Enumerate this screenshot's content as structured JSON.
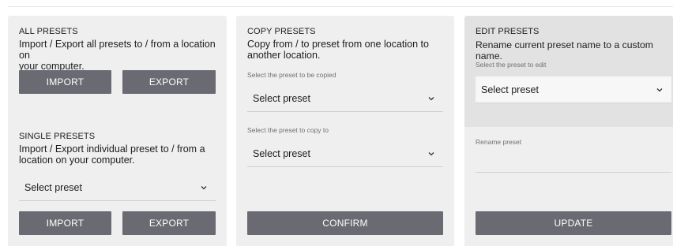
{
  "all_presets": {
    "heading": "ALL PRESETS",
    "description_line1": "Import / Export all presets to / from a location on",
    "description_line2": "your computer.",
    "import_label": "IMPORT",
    "export_label": "EXPORT"
  },
  "single_presets": {
    "heading": "SINGLE PRESETS",
    "description_line1": "Import / Export individual preset to / from a",
    "description_line2": "location on your computer.",
    "select_value": "Select preset",
    "import_label": "IMPORT",
    "export_label": "EXPORT"
  },
  "copy_presets": {
    "heading": "COPY PRESETS",
    "description_line1": "Copy from / to preset from one location to",
    "description_line2": "another location.",
    "source_hint": "Select the preset to be copied",
    "source_value": "Select preset",
    "target_hint": "Select the preset to copy to",
    "target_value": "Select preset",
    "confirm_label": "CONFIRM"
  },
  "edit_presets": {
    "heading": "EDIT PRESETS",
    "description": "Rename current preset name to a custom name.",
    "select_hint": "Select the preset to edit",
    "select_value": "Select preset",
    "rename_hint": "Rename preset",
    "update_label": "UPDATE"
  },
  "colors": {
    "button_bg": "#6a6a72",
    "panel_bg": "#efefef",
    "edit_shade": "#e2e2e2"
  },
  "icons": [
    "chevron-down-icon"
  ]
}
